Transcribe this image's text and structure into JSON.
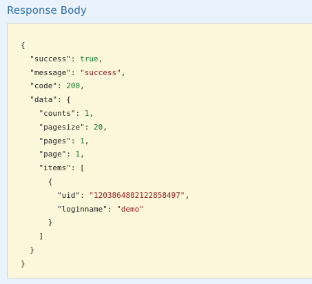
{
  "header": {
    "title": "Response Body"
  },
  "response": {
    "success_key": "\"success\"",
    "success_value": "true",
    "message_key": "\"message\"",
    "message_value": "\"success\"",
    "code_key": "\"code\"",
    "code_value": "200",
    "data_key": "\"data\"",
    "counts_key": "\"counts\"",
    "counts_value": "1",
    "pagesize_key": "\"pagesize\"",
    "pagesize_value": "20",
    "pages_key": "\"pages\"",
    "pages_value": "1",
    "page_key": "\"page\"",
    "page_value": "1",
    "items_key": "\"items\"",
    "uid_key": "\"uid\"",
    "uid_value": "\"1203864882122858497\"",
    "loginname_key": "\"loginname\"",
    "loginname_value": "\"demo\""
  },
  "colors": {
    "title": "#2d6ea8",
    "background": "#eaf2fb",
    "code_background": "#fcf6db",
    "string": "#8c1d1d",
    "number": "#0d7a2d"
  }
}
